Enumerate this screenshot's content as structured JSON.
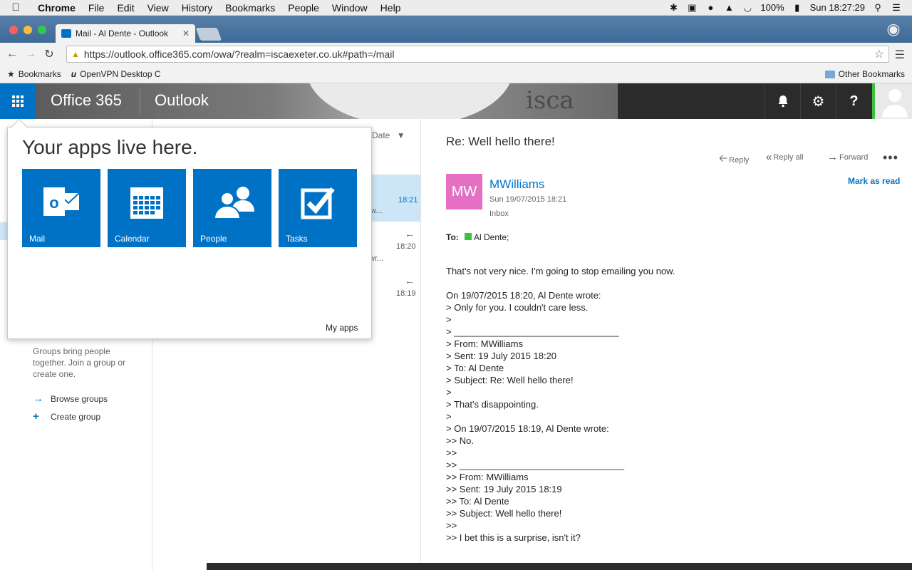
{
  "macbar": {
    "apple": "",
    "app": "Chrome",
    "menu": [
      "File",
      "Edit",
      "View",
      "History",
      "Bookmarks",
      "People",
      "Window",
      "Help"
    ],
    "battery": "100%",
    "clock": "Sun 18:27:29"
  },
  "browser": {
    "tab_title": "Mail - Al Dente - Outlook",
    "url": "https://outlook.office365.com/owa/?realm=iscaexeter.co.uk#path=/mail",
    "bookmarks": [
      "Bookmarks",
      "OpenVPN Desktop C"
    ],
    "other_bookmarks": "Other Bookmarks"
  },
  "header": {
    "suite": "Office 365",
    "app": "Outlook",
    "bg_logo": "isca"
  },
  "leftnav": {
    "groups_text": "Groups bring people together. Join a group or create one.",
    "browse_groups": "Browse groups",
    "create_group": "Create group"
  },
  "msglist": {
    "sort_label": "Date",
    "items": [
      {
        "time": "18:21",
        "snippet": "ow..."
      },
      {
        "time": "18:20",
        "snippet": "wr..."
      },
      {
        "time": "18:19",
        "snippet": ""
      }
    ]
  },
  "reading": {
    "subject": "Re: Well hello there!",
    "actions": {
      "reply": "Reply",
      "reply_all": "Reply all",
      "forward": "Forward"
    },
    "initials": "MW",
    "sender": "MWilliams",
    "sent": "Sun 19/07/2015 18:21",
    "folder": "Inbox",
    "mark_as_read": "Mark as read",
    "to_label": "To:",
    "to_name": "Al Dente;",
    "body_lines": [
      "That's not very nice. I'm going to stop emailing you now.",
      "",
      "On 19/07/2015 18:20, Al Dente wrote:",
      "> Only for you. I couldn't care less.",
      ">",
      "> ________________________________",
      "> From: MWilliams",
      "> Sent: 19 July 2015 18:20",
      "> To: Al Dente",
      "> Subject: Re: Well hello there!",
      ">",
      "> That's disappointing.",
      ">",
      "> On 19/07/2015 18:19, Al Dente wrote:",
      ">> No.",
      ">>",
      ">> ________________________________",
      ">> From: MWilliams",
      ">> Sent: 19 July 2015 18:19",
      ">> To: Al Dente",
      ">> Subject: Well hello there!",
      ">>",
      ">> I bet this is a surprise, isn't it?"
    ]
  },
  "flyout": {
    "heading": "Your apps live here.",
    "tiles": [
      {
        "label": "Mail",
        "icon": "mail-icon"
      },
      {
        "label": "Calendar",
        "icon": "calendar-icon"
      },
      {
        "label": "People",
        "icon": "people-icon"
      },
      {
        "label": "Tasks",
        "icon": "tasks-icon"
      }
    ],
    "my_apps": "My apps"
  },
  "colors": {
    "accent": "#0072c6",
    "avatar": "#e56fc2",
    "presence": "#3fbf3f",
    "selected_row": "#cde6f7"
  }
}
